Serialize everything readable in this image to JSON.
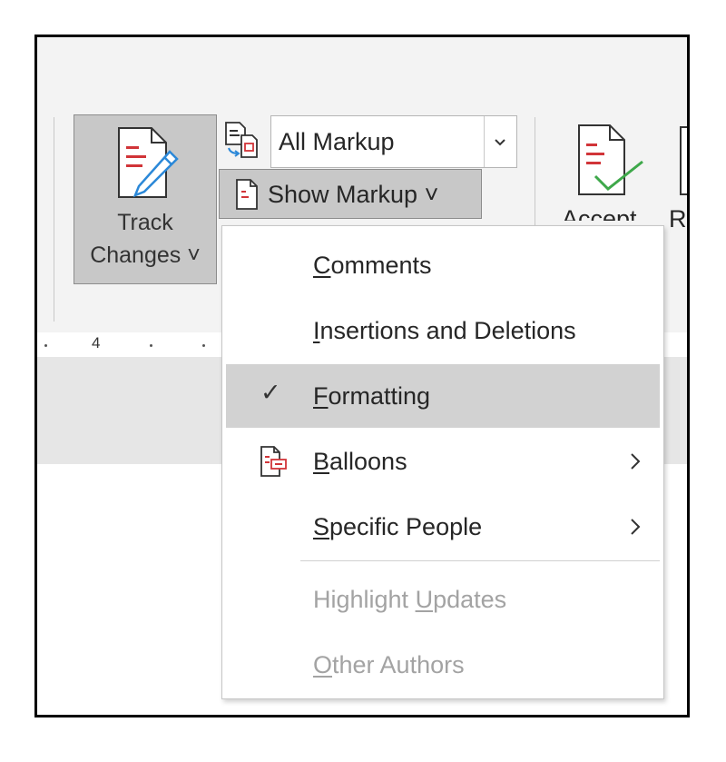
{
  "ribbon": {
    "track_changes": {
      "line1": "Track",
      "line2": "Changes ˅"
    },
    "markup_select": {
      "value": "All Markup"
    },
    "show_markup": {
      "label": "Show Markup ˅"
    },
    "accept": {
      "label": "Accept"
    },
    "reject": {
      "label": "Re"
    }
  },
  "ruler": {
    "number": "4"
  },
  "menu": {
    "items": [
      {
        "pre": "",
        "u": "C",
        "post": "omments",
        "state": "normal"
      },
      {
        "pre": "",
        "u": "I",
        "post": "nsertions and Deletions",
        "state": "normal"
      },
      {
        "pre": "",
        "u": "F",
        "post": "ormatting",
        "state": "checked"
      },
      {
        "pre": "",
        "u": "B",
        "post": "alloons",
        "state": "submenu",
        "icon": "balloons-icon"
      },
      {
        "pre": "",
        "u": "S",
        "post": "pecific People",
        "state": "submenu"
      },
      {
        "pre": "Highlight ",
        "u": "U",
        "post": "pdates",
        "state": "disabled"
      },
      {
        "pre": "",
        "u": "O",
        "post": "ther Authors",
        "state": "disabled"
      }
    ],
    "check_glyph": "✓"
  },
  "colors": {
    "ribbon_bg": "#f3f3f3",
    "pressed_bg": "#c8c8c8",
    "accent_red": "#d13438",
    "accent_blue": "#2b88d8",
    "accept_green": "#3ea84a",
    "disabled_text": "#a3a3a3"
  }
}
